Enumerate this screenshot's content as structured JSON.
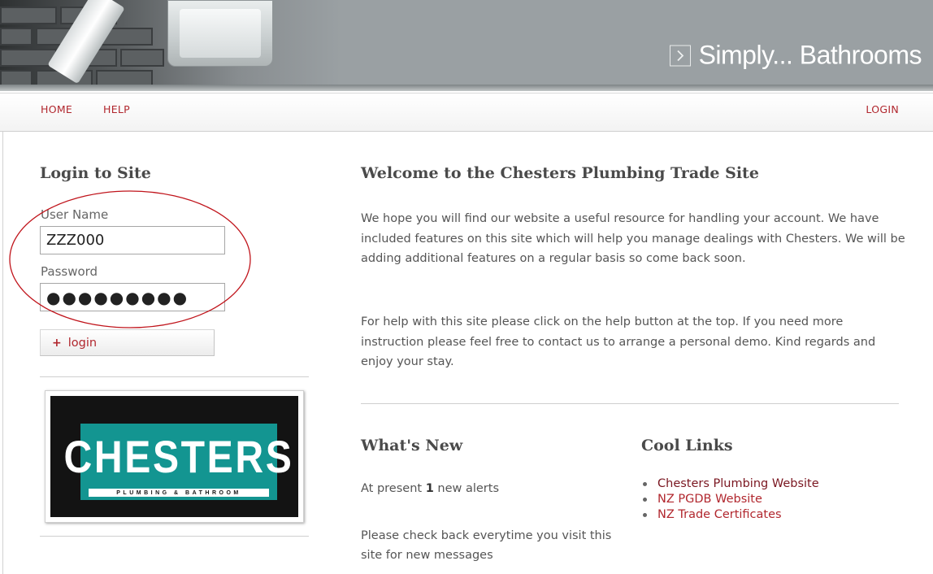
{
  "header": {
    "tagline": "Simply... Bathrooms",
    "tagline_icon": "chevron-right-box-icon"
  },
  "nav": {
    "home": "HOME",
    "help": "HELP",
    "login": "LOGIN"
  },
  "login_form": {
    "title": "Login to Site",
    "username_label": "User Name",
    "username_value": "ZZZ000",
    "password_label": "Password",
    "password_value": "●●●●●●●●●",
    "button_icon": "+",
    "button_label": "login"
  },
  "logo": {
    "word": "CHESTERS",
    "sub": "PLUMBING & BATHROOM"
  },
  "welcome": {
    "title": "Welcome to the Chesters Plumbing Trade Site",
    "para1": "We hope you will find our website a useful resource for handling your account. We have included features on this site which will help you manage dealings with Chesters. We will be adding additional features on a regular basis so come back soon.",
    "para2": "For help with this site please click on the help button at the top. If you need more instruction please feel free to contact us to arrange a personal demo. Kind regards and enjoy your stay."
  },
  "whats_new": {
    "title": "What's New",
    "alerts_prefix": "At present",
    "alerts_count": "1",
    "alerts_suffix": "new alerts",
    "check_back": "Please check back everytime you visit this site for new messages"
  },
  "cool_links": {
    "title": "Cool Links",
    "items": [
      {
        "label": "Chesters Plumbing Website"
      },
      {
        "label": "NZ PGDB Website"
      },
      {
        "label": "NZ Trade Certificates"
      }
    ]
  },
  "colors": {
    "accent_red": "#b1272e",
    "dark_red": "#7a1620",
    "logo_teal": "#139591",
    "annotation": "#c0141b"
  }
}
